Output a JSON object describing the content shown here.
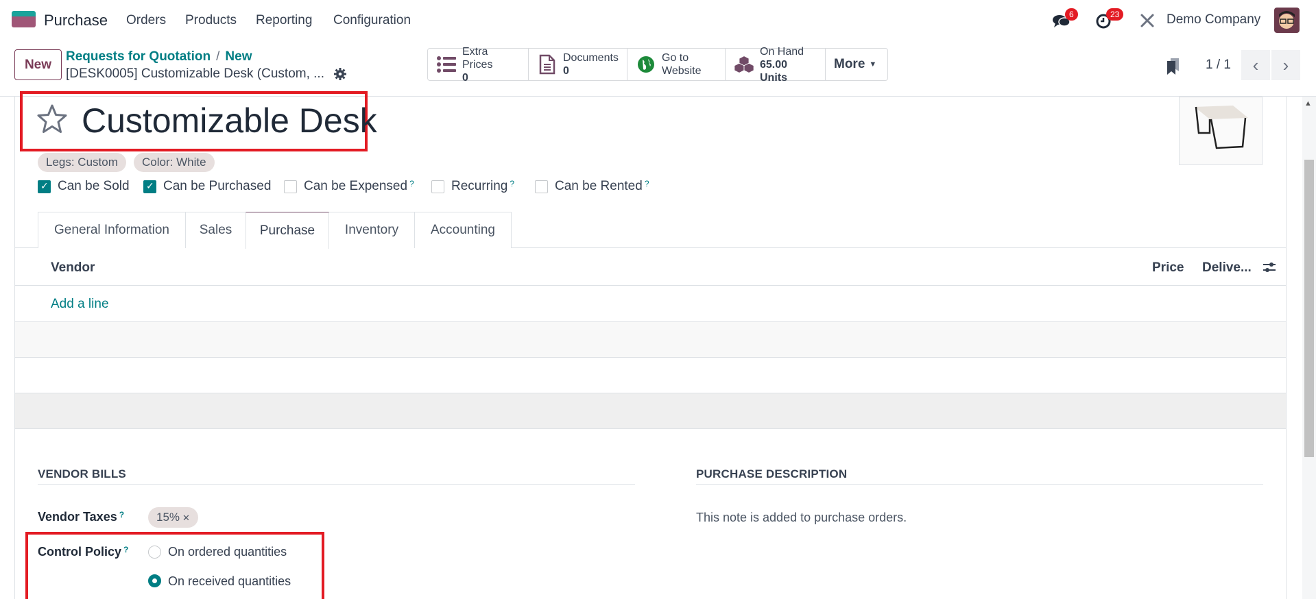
{
  "navbar": {
    "app_name": "Purchase",
    "menu": [
      "Orders",
      "Products",
      "Reporting",
      "Configuration"
    ],
    "messages_badge": "6",
    "activities_badge": "23",
    "company": "Demo Company"
  },
  "control_panel": {
    "new_label": "New",
    "breadcrumb": [
      "Requests for Quotation",
      "New"
    ],
    "record_name": "[DESK0005] Customizable Desk (Custom, ...",
    "stat_buttons": [
      {
        "label": "Extra Prices",
        "value": "0",
        "icon": "list-icon"
      },
      {
        "label": "Documents",
        "value": "0",
        "icon": "document-icon"
      },
      {
        "label": "Go to",
        "value": "Website",
        "icon": "globe-icon"
      },
      {
        "label": "On Hand",
        "value": "65.00 Units",
        "icon": "cubes-icon"
      }
    ],
    "more_label": "More",
    "pager": "1 / 1"
  },
  "product": {
    "name": "Customizable Desk",
    "tags": [
      "Legs: Custom",
      "Color: White"
    ],
    "checkboxes": [
      {
        "label": "Can be Sold",
        "checked": true,
        "help": false
      },
      {
        "label": "Can be Purchased",
        "checked": true,
        "help": false
      },
      {
        "label": "Can be Expensed",
        "checked": false,
        "help": true
      },
      {
        "label": "Recurring",
        "checked": false,
        "help": true
      },
      {
        "label": "Can be Rented",
        "checked": false,
        "help": true
      }
    ],
    "help_mark": "?"
  },
  "tabs": [
    {
      "label": "General Information",
      "active": false
    },
    {
      "label": "Sales",
      "active": false
    },
    {
      "label": "Purchase",
      "active": true
    },
    {
      "label": "Inventory",
      "active": false
    },
    {
      "label": "Accounting",
      "active": false
    }
  ],
  "vendor_list": {
    "columns": [
      "Vendor",
      "Price",
      "Delive..."
    ],
    "add_line": "Add a line"
  },
  "vendor_bills": {
    "title": "VENDOR BILLS",
    "vendor_taxes_label": "Vendor Taxes",
    "vendor_taxes": [
      "15%"
    ],
    "control_policy_label": "Control Policy",
    "control_policy_options": [
      {
        "label": "On ordered quantities",
        "selected": false
      },
      {
        "label": "On received quantities",
        "selected": true
      }
    ]
  },
  "purchase_description": {
    "title": "PURCHASE DESCRIPTION",
    "placeholder": "This note is added to purchase orders."
  },
  "colors": {
    "brand": "#714b67",
    "accent": "#017e84",
    "highlight": "#e31b23"
  }
}
